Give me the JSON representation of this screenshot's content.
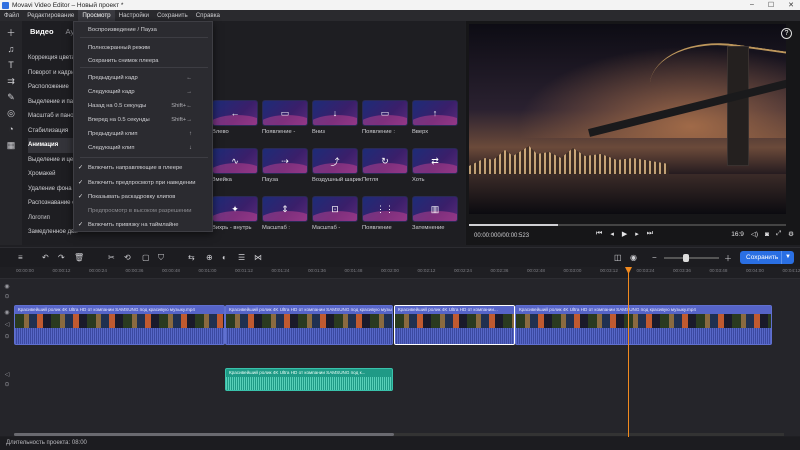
{
  "window": {
    "title": "Movavi Video Editor – Новый проект *"
  },
  "menu": {
    "items": [
      "Файл",
      "Редактирование",
      "Просмотр",
      "Настройки",
      "Сохранить",
      "Справка"
    ],
    "active_index": 2
  },
  "panel": {
    "tabs": [
      "Видео",
      "Аудио"
    ],
    "categories": [
      "Коррекция цвета",
      "Поворот и кадрир.",
      "Расположение",
      "Выделение и панор.",
      "Масштаб и панор.",
      "Стабилизация",
      "Анимация",
      "Выделение и цен.",
      "Хромакей",
      "Удаление фона",
      "Распознавание св.",
      "Логотип",
      "Замедленное дви."
    ],
    "active_category": "Анимация"
  },
  "transitions": [
    {
      "label": "Влево",
      "glyph": "←"
    },
    {
      "label": "Появление -",
      "glyph": "▭"
    },
    {
      "label": "Вниз",
      "glyph": "↓"
    },
    {
      "label": "Появление :",
      "glyph": "▭"
    },
    {
      "label": "Вверх",
      "glyph": "↑"
    },
    {
      "label": "Змейка",
      "glyph": "∿"
    },
    {
      "label": "Пауза",
      "glyph": "⇢"
    },
    {
      "label": "Воздушный шарик",
      "glyph": "⤴"
    },
    {
      "label": "Петля",
      "glyph": "↻"
    },
    {
      "label": "Хоть",
      "glyph": "⇄"
    },
    {
      "label": "Вихрь - внутрь",
      "glyph": "✦"
    },
    {
      "label": "Масштаб :",
      "glyph": "⇕"
    },
    {
      "label": "Масштаб -",
      "glyph": "⊡"
    },
    {
      "label": "Появление",
      "glyph": "⋮⋮"
    },
    {
      "label": "Затемнение",
      "glyph": "▥"
    }
  ],
  "dropdown": {
    "items": [
      {
        "label": "Воспроизведение / Пауза",
        "shortcut": "",
        "check": false,
        "dim": false
      },
      {
        "label": "Полноэкранный режим",
        "shortcut": "",
        "check": false,
        "dim": false
      },
      {
        "label": "Сохранить снимок плеера",
        "shortcut": "",
        "check": false,
        "dim": false
      },
      {
        "label": "Предыдущий кадр",
        "shortcut": "←",
        "check": false,
        "dim": false
      },
      {
        "label": "Следующий кадр",
        "shortcut": "→",
        "check": false,
        "dim": false
      },
      {
        "label": "Назад на 0.5 секунды",
        "shortcut": "Shift+←",
        "check": false,
        "dim": false
      },
      {
        "label": "Вперед на 0.5 секунды",
        "shortcut": "Shift+→",
        "check": false,
        "dim": false
      },
      {
        "label": "Предыдущий клип",
        "shortcut": "↑",
        "check": false,
        "dim": false
      },
      {
        "label": "Следующий клип",
        "shortcut": "↓",
        "check": false,
        "dim": false
      },
      {
        "label": "Включить направляющие в плеере",
        "shortcut": "",
        "check": true,
        "dim": false
      },
      {
        "label": "Включить предпросмотр при наведении",
        "shortcut": "",
        "check": true,
        "dim": false
      },
      {
        "label": "Показывать раскадровку клипов",
        "shortcut": "",
        "check": true,
        "dim": false
      },
      {
        "label": "Предпросмотр в высоком разрешении",
        "shortcut": "",
        "check": false,
        "dim": true
      },
      {
        "label": "Включить привязку на таймлайне",
        "shortcut": "",
        "check": true,
        "dim": false
      }
    ]
  },
  "player": {
    "time": "00:00:000/00:00:523",
    "aspect": "16:9",
    "help": "?",
    "progress": 0.28
  },
  "toolbar": {
    "save_label": "Сохранить"
  },
  "ruler": [
    "00:00:00",
    "00:00:12",
    "00:00:24",
    "00:00:36",
    "00:00:48",
    "00:01:00",
    "00:01:12",
    "00:01:24",
    "00:01:36",
    "00:01:48",
    "00:02:00",
    "00:02:12",
    "00:02:24",
    "00:02:36",
    "00:02:48",
    "00:03:00",
    "00:03:12",
    "00:03:24",
    "00:03:36",
    "00:03:48",
    "00:04:00",
    "00:04:12"
  ],
  "clips": [
    {
      "title": "Красивейший ролик 4K Ultra HD от компании SAMSUNG под красивую музыку.mp4"
    },
    {
      "title": "Красивейший ролик 4K Ultra HD от компании SAMSUNG под красивую музыку.mp4"
    },
    {
      "title": "Красивейший ролик 4K Ultra HD от компании..."
    },
    {
      "title": "Красивейший ролик 4K Ultra HD от компании SAMSUNG под красивую музыку.mp4"
    }
  ],
  "audio_clip": {
    "title": "Красивейший ролик 4K Ultra HD от компании SAMSUNG под к..."
  },
  "status": {
    "text": "Длительность проекта: 08:00"
  }
}
